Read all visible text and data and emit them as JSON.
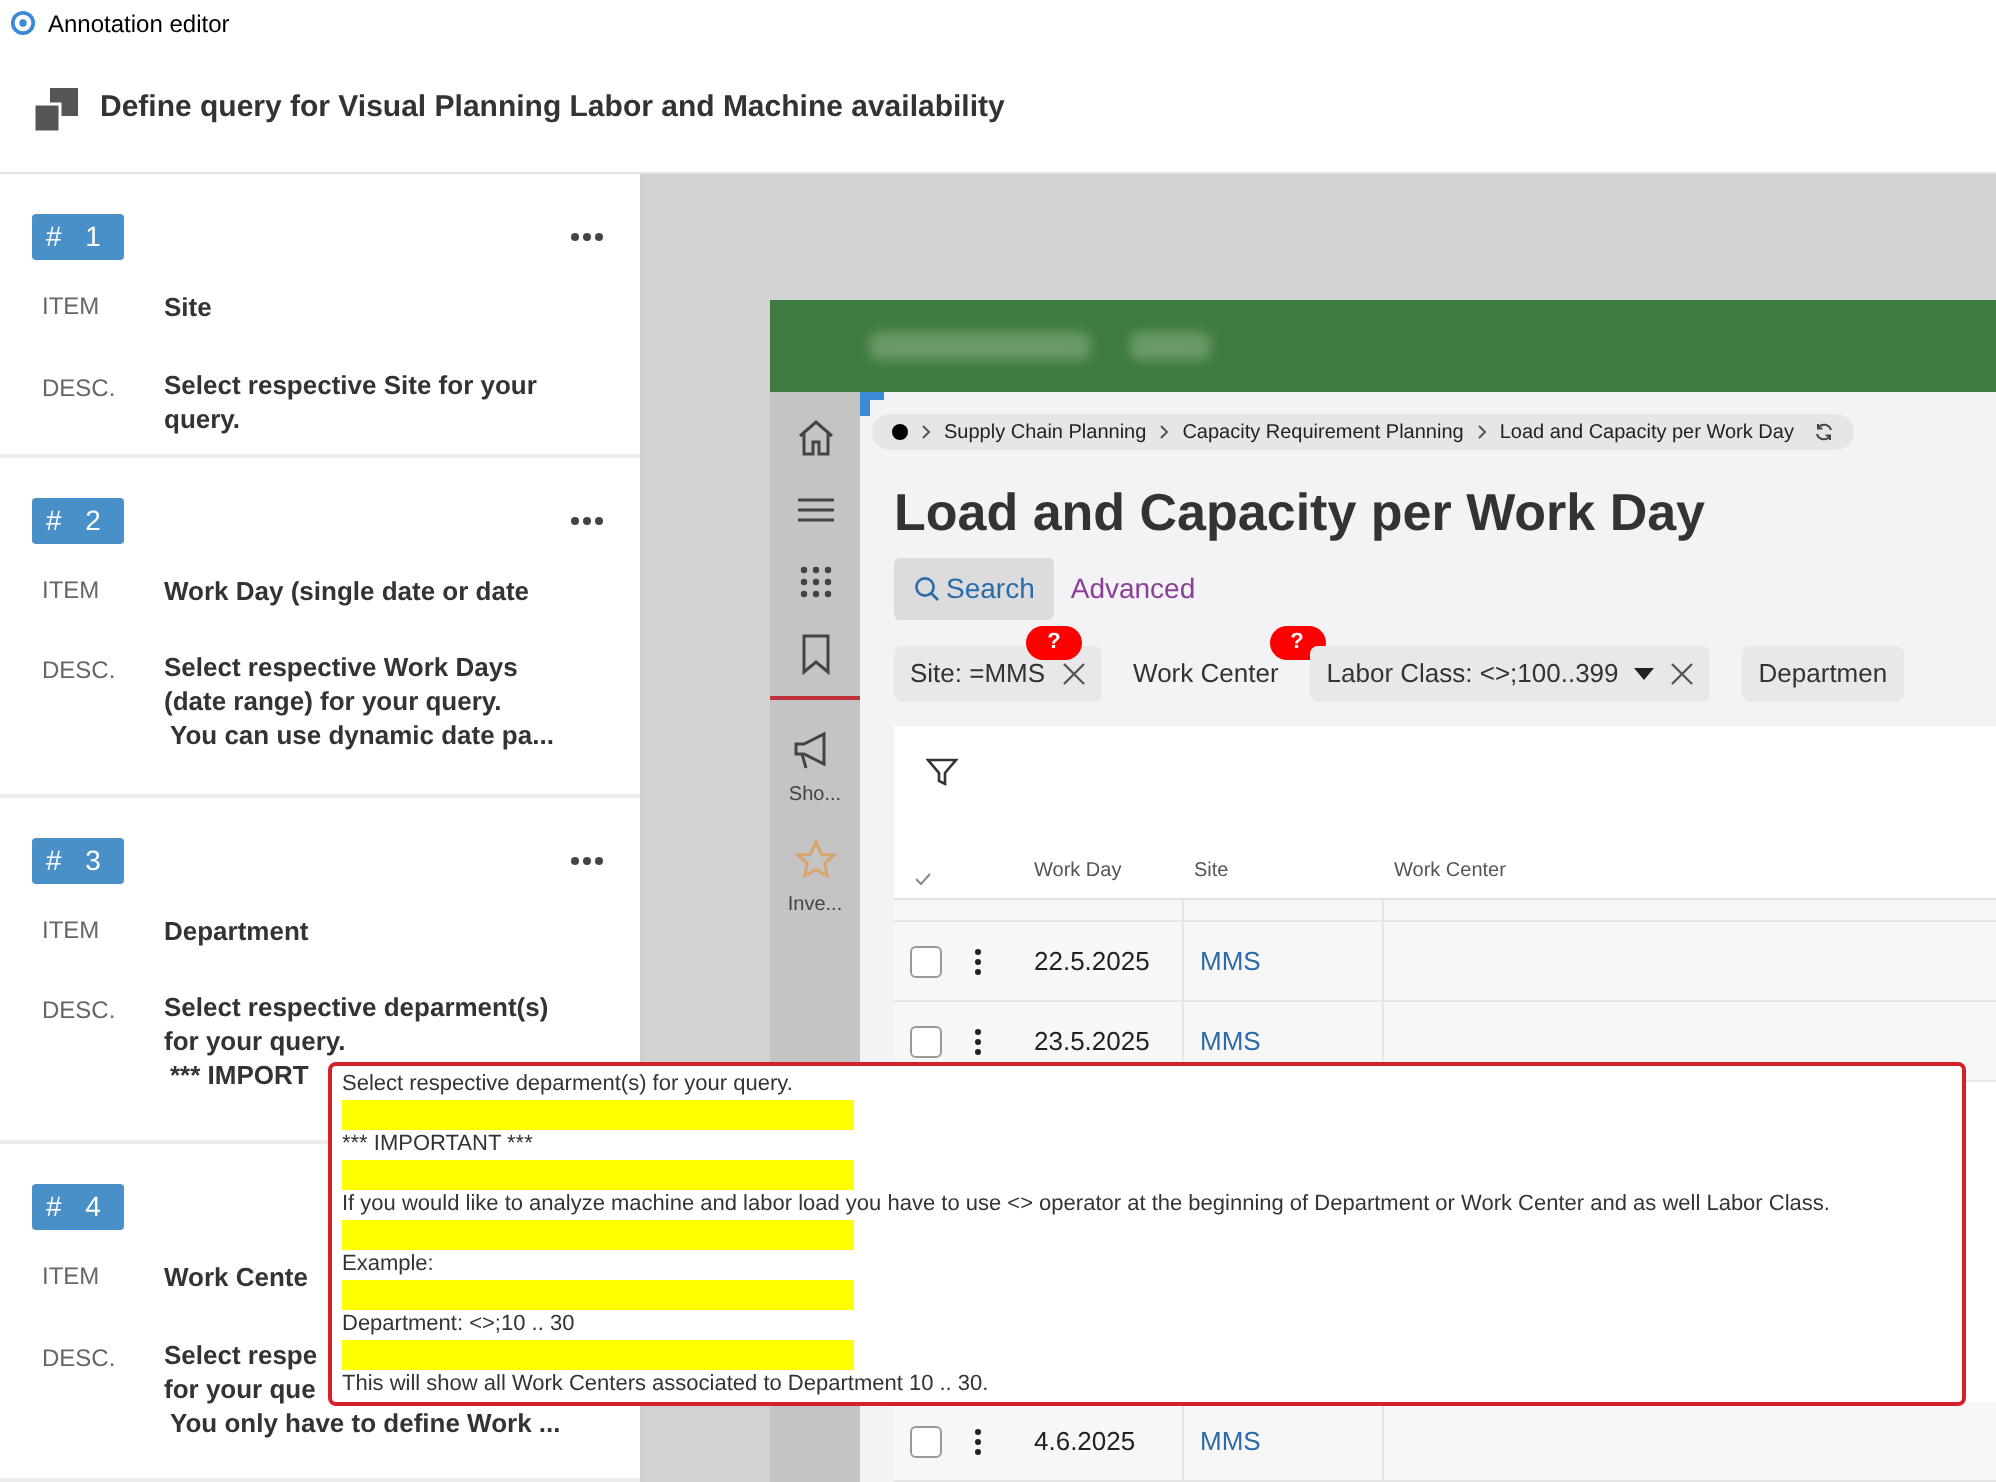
{
  "window": {
    "title": "Annotation editor"
  },
  "header": {
    "title": "Define query for Visual Planning Labor and Machine availability"
  },
  "annotations": [
    {
      "number": "# 1",
      "item_label": "ITEM",
      "item": "Site",
      "desc_label": "DESC.",
      "desc": [
        "Select respective Site for your",
        "query."
      ]
    },
    {
      "number": "# 2",
      "item_label": "ITEM",
      "item": "Work Day (single date or date",
      "desc_label": "DESC.",
      "desc": [
        "Select respective Work Days",
        "(date range) for your query.",
        "You can use dynamic date pa..."
      ]
    },
    {
      "number": "# 3",
      "item_label": "ITEM",
      "item": "Department",
      "desc_label": "DESC.",
      "desc": [
        "Select respective deparment(s)",
        "for your query.",
        "*** IMPORT"
      ]
    },
    {
      "number": "# 4",
      "item_label": "ITEM",
      "item": "Work Cente",
      "desc_label": "DESC.",
      "desc": [
        "Select respe",
        "for your que",
        "You only have to define Work ..."
      ]
    }
  ],
  "app": {
    "nav": [
      {
        "kind": "home"
      },
      {
        "kind": "menu"
      },
      {
        "kind": "grid"
      },
      {
        "kind": "bookmark"
      },
      {
        "kind": "megaphone",
        "label": "Sho..."
      },
      {
        "kind": "star",
        "label": "Inve..."
      }
    ],
    "breadcrumb": [
      "Supply Chain Planning",
      "Capacity Requirement Planning",
      "Load and Capacity per Work Day"
    ],
    "title": "Load and Capacity per Work Day",
    "search_tabs": [
      {
        "label": "Search",
        "selected": true
      },
      {
        "label": "Advanced",
        "selected": false
      }
    ],
    "filters": [
      {
        "label": "Site: =MMS",
        "badge": "?",
        "removable": true,
        "dropdown": false,
        "filled": true
      },
      {
        "label": "Work Center",
        "badge": "?",
        "removable": false,
        "dropdown": false,
        "filled": false
      },
      {
        "label": "Labor Class: <>;100..399",
        "removable": true,
        "dropdown": true,
        "filled": true
      },
      {
        "label": "Departmen",
        "removable": false,
        "dropdown": false,
        "filled": true
      }
    ],
    "table": {
      "columns": [
        "Work Day",
        "Site",
        "Work Center"
      ],
      "rows": [
        {
          "work_day": "22.5.2025",
          "site": "MMS",
          "checked": false
        },
        {
          "work_day": "23.5.2025",
          "site": "MMS",
          "checked": false
        },
        {
          "work_day": "4.6.2025",
          "site": "MMS",
          "checked": false
        }
      ]
    }
  },
  "tooltip": {
    "lines": [
      "Select respective deparment(s) for your query.",
      "*** IMPORTANT ***",
      "If you would like to analyze machine and labor load you have to use <> operator at the beginning of Department or Work Center and as well Labor Class.",
      "Example:",
      "Department: <>;10 .. 30",
      "This will show all Work Centers associated to Department 10 .. 30."
    ]
  }
}
